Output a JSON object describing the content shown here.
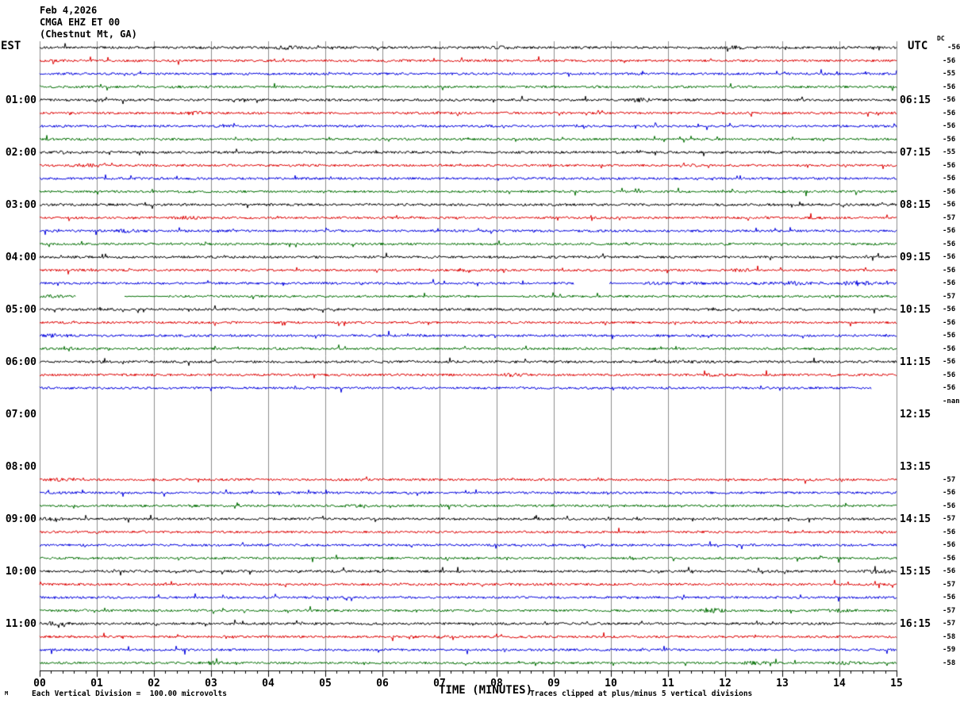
{
  "title": {
    "date": "Feb 4,2026",
    "station": "CMGA EHZ ET 00",
    "location": "(Chestnut Mt, GA)"
  },
  "axes": {
    "left_timezone": "EST",
    "right_timezone": "UTC",
    "dc_header": "DC",
    "x_axis_title": "TIME (MINUTES)",
    "x_ticks": [
      "00",
      "01",
      "02",
      "03",
      "04",
      "05",
      "06",
      "07",
      "08",
      "09",
      "10",
      "11",
      "12",
      "13",
      "14",
      "15"
    ],
    "left_hour_labels": [
      {
        "row": 4,
        "label": "01:00"
      },
      {
        "row": 8,
        "label": "02:00"
      },
      {
        "row": 12,
        "label": "03:00"
      },
      {
        "row": 16,
        "label": "04:00"
      },
      {
        "row": 20,
        "label": "05:00"
      },
      {
        "row": 24,
        "label": "06:00"
      },
      {
        "row": 28,
        "label": "07:00"
      },
      {
        "row": 32,
        "label": "08:00"
      },
      {
        "row": 36,
        "label": "09:00"
      },
      {
        "row": 40,
        "label": "10:00"
      },
      {
        "row": 44,
        "label": "11:00"
      }
    ],
    "right_hour_labels": [
      {
        "row": 4,
        "label": "06:15"
      },
      {
        "row": 8,
        "label": "07:15"
      },
      {
        "row": 12,
        "label": "08:15"
      },
      {
        "row": 16,
        "label": "09:15"
      },
      {
        "row": 20,
        "label": "10:15"
      },
      {
        "row": 24,
        "label": "11:15"
      },
      {
        "row": 28,
        "label": "12:15"
      },
      {
        "row": 32,
        "label": "13:15"
      },
      {
        "row": 36,
        "label": "14:15"
      },
      {
        "row": 40,
        "label": "15:15"
      },
      {
        "row": 44,
        "label": "16:15"
      }
    ]
  },
  "footer": {
    "left": "Each Vertical Division =  100.00 microvolts",
    "right": "Traces clipped at plus/minus 5 vertical divisions",
    "corner_mark": "M"
  },
  "colors": {
    "black": "#000000",
    "red": "#dd0000",
    "blue": "#0000dd",
    "green": "#006e00",
    "grid": "#8c8c8c",
    "axis": "#000000"
  },
  "chart_data": {
    "type": "helicorder",
    "minutes_per_row": 15,
    "x_range_minutes": [
      0,
      15
    ],
    "note_missing_rows": "06:45 trace is -nan; rows 07:00 through 08:00 EST are blank (no data)",
    "rows": [
      {
        "est": "00:00",
        "color": "black",
        "dc": "-56",
        "segments": [
          [
            0,
            15,
            1
          ]
        ],
        "bursts": [
          [
            4.3,
            1.8
          ],
          [
            8.1,
            1.5
          ],
          [
            12.2,
            1.7
          ]
        ]
      },
      {
        "est": "00:15",
        "color": "red",
        "dc": "-56",
        "segments": [
          [
            0,
            15,
            1
          ]
        ],
        "bursts": []
      },
      {
        "est": "00:30",
        "color": "blue",
        "dc": "-55",
        "segments": [
          [
            0,
            15,
            1
          ]
        ],
        "bursts": []
      },
      {
        "est": "00:45",
        "color": "green",
        "dc": "-56",
        "segments": [
          [
            0,
            15,
            1
          ]
        ],
        "bursts": [
          [
            2.2,
            1.5
          ]
        ]
      },
      {
        "est": "01:00",
        "color": "black",
        "dc": "-56",
        "segments": [
          [
            0,
            15,
            1
          ]
        ],
        "bursts": [
          [
            10.5,
            2.1
          ]
        ]
      },
      {
        "est": "01:15",
        "color": "red",
        "dc": "-56",
        "segments": [
          [
            0,
            15,
            1
          ]
        ],
        "bursts": [
          [
            2.7,
            1.7
          ]
        ]
      },
      {
        "est": "01:30",
        "color": "blue",
        "dc": "-56",
        "segments": [
          [
            0,
            15,
            1
          ]
        ],
        "bursts": []
      },
      {
        "est": "01:45",
        "color": "green",
        "dc": "-56",
        "segments": [
          [
            0,
            15,
            1
          ]
        ],
        "bursts": []
      },
      {
        "est": "02:00",
        "color": "black",
        "dc": "-55",
        "segments": [
          [
            0,
            15,
            1
          ]
        ],
        "bursts": [
          [
            0.4,
            1.6
          ]
        ]
      },
      {
        "est": "02:15",
        "color": "red",
        "dc": "-56",
        "segments": [
          [
            0,
            15,
            1
          ]
        ],
        "bursts": [
          [
            0.8,
            1.9
          ]
        ]
      },
      {
        "est": "02:30",
        "color": "blue",
        "dc": "-56",
        "segments": [
          [
            0,
            15,
            1
          ]
        ],
        "bursts": []
      },
      {
        "est": "02:45",
        "color": "green",
        "dc": "-56",
        "segments": [
          [
            0,
            15,
            1
          ]
        ],
        "bursts": []
      },
      {
        "est": "03:00",
        "color": "black",
        "dc": "-56",
        "segments": [
          [
            0,
            15,
            1
          ]
        ],
        "bursts": []
      },
      {
        "est": "03:15",
        "color": "red",
        "dc": "-57",
        "segments": [
          [
            0,
            15,
            1
          ]
        ],
        "bursts": [
          [
            2.6,
            1.7
          ]
        ]
      },
      {
        "est": "03:30",
        "color": "blue",
        "dc": "-56",
        "segments": [
          [
            0,
            15,
            1
          ]
        ],
        "bursts": [
          [
            1.5,
            1.8
          ],
          [
            7.2,
            1.5
          ]
        ]
      },
      {
        "est": "03:45",
        "color": "green",
        "dc": "-56",
        "segments": [
          [
            0,
            15,
            1
          ]
        ],
        "bursts": []
      },
      {
        "est": "04:00",
        "color": "black",
        "dc": "-56",
        "segments": [
          [
            0,
            15,
            1
          ]
        ],
        "bursts": []
      },
      {
        "est": "04:15",
        "color": "red",
        "dc": "-56",
        "segments": [
          [
            0,
            15,
            1
          ]
        ],
        "bursts": [
          [
            7.5,
            1.5
          ],
          [
            12.3,
            1.6
          ]
        ]
      },
      {
        "est": "04:30",
        "color": "blue",
        "dc": "-56",
        "segments": [
          [
            0,
            9.35,
            1
          ],
          [
            9.97,
            10.55,
            0.45
          ],
          [
            10.55,
            15,
            1.25
          ]
        ],
        "bursts": [
          [
            13.2,
            1.6
          ],
          [
            14.3,
            1.9
          ]
        ]
      },
      {
        "est": "04:45",
        "color": "green",
        "dc": "-57",
        "segments": [
          [
            0,
            0.63,
            1
          ],
          [
            1.48,
            2.25,
            0.3
          ],
          [
            2.25,
            7.7,
            1
          ],
          [
            7.7,
            8.45,
            0.3
          ],
          [
            8.45,
            15,
            1
          ]
        ],
        "bursts": [
          [
            0.3,
            1.5
          ]
        ]
      },
      {
        "est": "05:00",
        "color": "black",
        "dc": "-56",
        "segments": [
          [
            0,
            15,
            1
          ]
        ],
        "bursts": []
      },
      {
        "est": "05:15",
        "color": "red",
        "dc": "-56",
        "segments": [
          [
            0,
            15,
            1
          ]
        ],
        "bursts": []
      },
      {
        "est": "05:30",
        "color": "blue",
        "dc": "-56",
        "segments": [
          [
            0,
            15,
            1
          ]
        ],
        "bursts": [
          [
            0.3,
            2.0
          ]
        ]
      },
      {
        "est": "05:45",
        "color": "green",
        "dc": "-56",
        "segments": [
          [
            0,
            15,
            1
          ]
        ],
        "bursts": []
      },
      {
        "est": "06:00",
        "color": "black",
        "dc": "-56",
        "segments": [
          [
            0,
            15,
            1
          ]
        ],
        "bursts": [
          [
            11.2,
            1.5
          ]
        ]
      },
      {
        "est": "06:15",
        "color": "red",
        "dc": "-56",
        "segments": [
          [
            0,
            15,
            1
          ]
        ],
        "bursts": [
          [
            8.3,
            1.9
          ],
          [
            11.8,
            1.6
          ]
        ]
      },
      {
        "est": "06:30",
        "color": "blue",
        "dc": "-56",
        "segments": [
          [
            0,
            14.55,
            1
          ]
        ],
        "bursts": []
      },
      {
        "est": "06:45",
        "color": "green",
        "dc": "-nan",
        "segments": [],
        "bursts": []
      },
      {
        "est": "07:00",
        "color": "black",
        "dc": "",
        "segments": [],
        "bursts": []
      },
      {
        "est": "07:15",
        "color": "red",
        "dc": "",
        "segments": [],
        "bursts": []
      },
      {
        "est": "07:30",
        "color": "blue",
        "dc": "",
        "segments": [],
        "bursts": []
      },
      {
        "est": "07:45",
        "color": "green",
        "dc": "",
        "segments": [],
        "bursts": []
      },
      {
        "est": "08:00",
        "color": "black",
        "dc": "",
        "segments": [],
        "bursts": []
      },
      {
        "est": "08:15",
        "color": "red",
        "dc": "-57",
        "segments": [
          [
            0,
            15,
            1
          ]
        ],
        "bursts": [
          [
            0.3,
            1.5
          ]
        ]
      },
      {
        "est": "08:30",
        "color": "blue",
        "dc": "-56",
        "segments": [
          [
            0,
            15,
            1
          ]
        ],
        "bursts": []
      },
      {
        "est": "08:45",
        "color": "green",
        "dc": "-56",
        "segments": [
          [
            0,
            15,
            1
          ]
        ],
        "bursts": [
          [
            5.5,
            1.5
          ]
        ]
      },
      {
        "est": "09:00",
        "color": "black",
        "dc": "-57",
        "segments": [
          [
            0,
            15,
            1
          ]
        ],
        "bursts": [
          [
            0.2,
            1.6
          ]
        ]
      },
      {
        "est": "09:15",
        "color": "red",
        "dc": "-56",
        "segments": [
          [
            0,
            15,
            1
          ]
        ],
        "bursts": []
      },
      {
        "est": "09:30",
        "color": "blue",
        "dc": "-56",
        "segments": [
          [
            0,
            15,
            1
          ]
        ],
        "bursts": []
      },
      {
        "est": "09:45",
        "color": "green",
        "dc": "-56",
        "segments": [
          [
            0,
            15,
            1
          ]
        ],
        "bursts": []
      },
      {
        "est": "10:00",
        "color": "black",
        "dc": "-56",
        "segments": [
          [
            0,
            15,
            1
          ]
        ],
        "bursts": [
          [
            14.7,
            2.4
          ]
        ]
      },
      {
        "est": "10:15",
        "color": "red",
        "dc": "-57",
        "segments": [
          [
            0,
            15,
            1
          ]
        ],
        "bursts": []
      },
      {
        "est": "10:30",
        "color": "blue",
        "dc": "-56",
        "segments": [
          [
            0,
            15,
            1
          ]
        ],
        "bursts": []
      },
      {
        "est": "10:45",
        "color": "green",
        "dc": "-57",
        "segments": [
          [
            0,
            15,
            1
          ]
        ],
        "bursts": [
          [
            11.8,
            2.1
          ],
          [
            14.0,
            1.7
          ]
        ]
      },
      {
        "est": "11:00",
        "color": "black",
        "dc": "-57",
        "segments": [
          [
            0,
            15,
            1
          ]
        ],
        "bursts": [
          [
            0.3,
            2.4
          ]
        ]
      },
      {
        "est": "11:15",
        "color": "red",
        "dc": "-58",
        "segments": [
          [
            0,
            15,
            1
          ]
        ],
        "bursts": [
          [
            7.0,
            1.6
          ]
        ]
      },
      {
        "est": "11:30",
        "color": "blue",
        "dc": "-59",
        "segments": [
          [
            0,
            15,
            1
          ]
        ],
        "bursts": []
      },
      {
        "est": "11:45",
        "color": "green",
        "dc": "-58",
        "segments": [
          [
            0,
            15,
            1
          ]
        ],
        "bursts": [
          [
            3.0,
            1.7
          ],
          [
            12.5,
            1.9
          ],
          [
            14.1,
            1.7
          ]
        ]
      }
    ]
  }
}
